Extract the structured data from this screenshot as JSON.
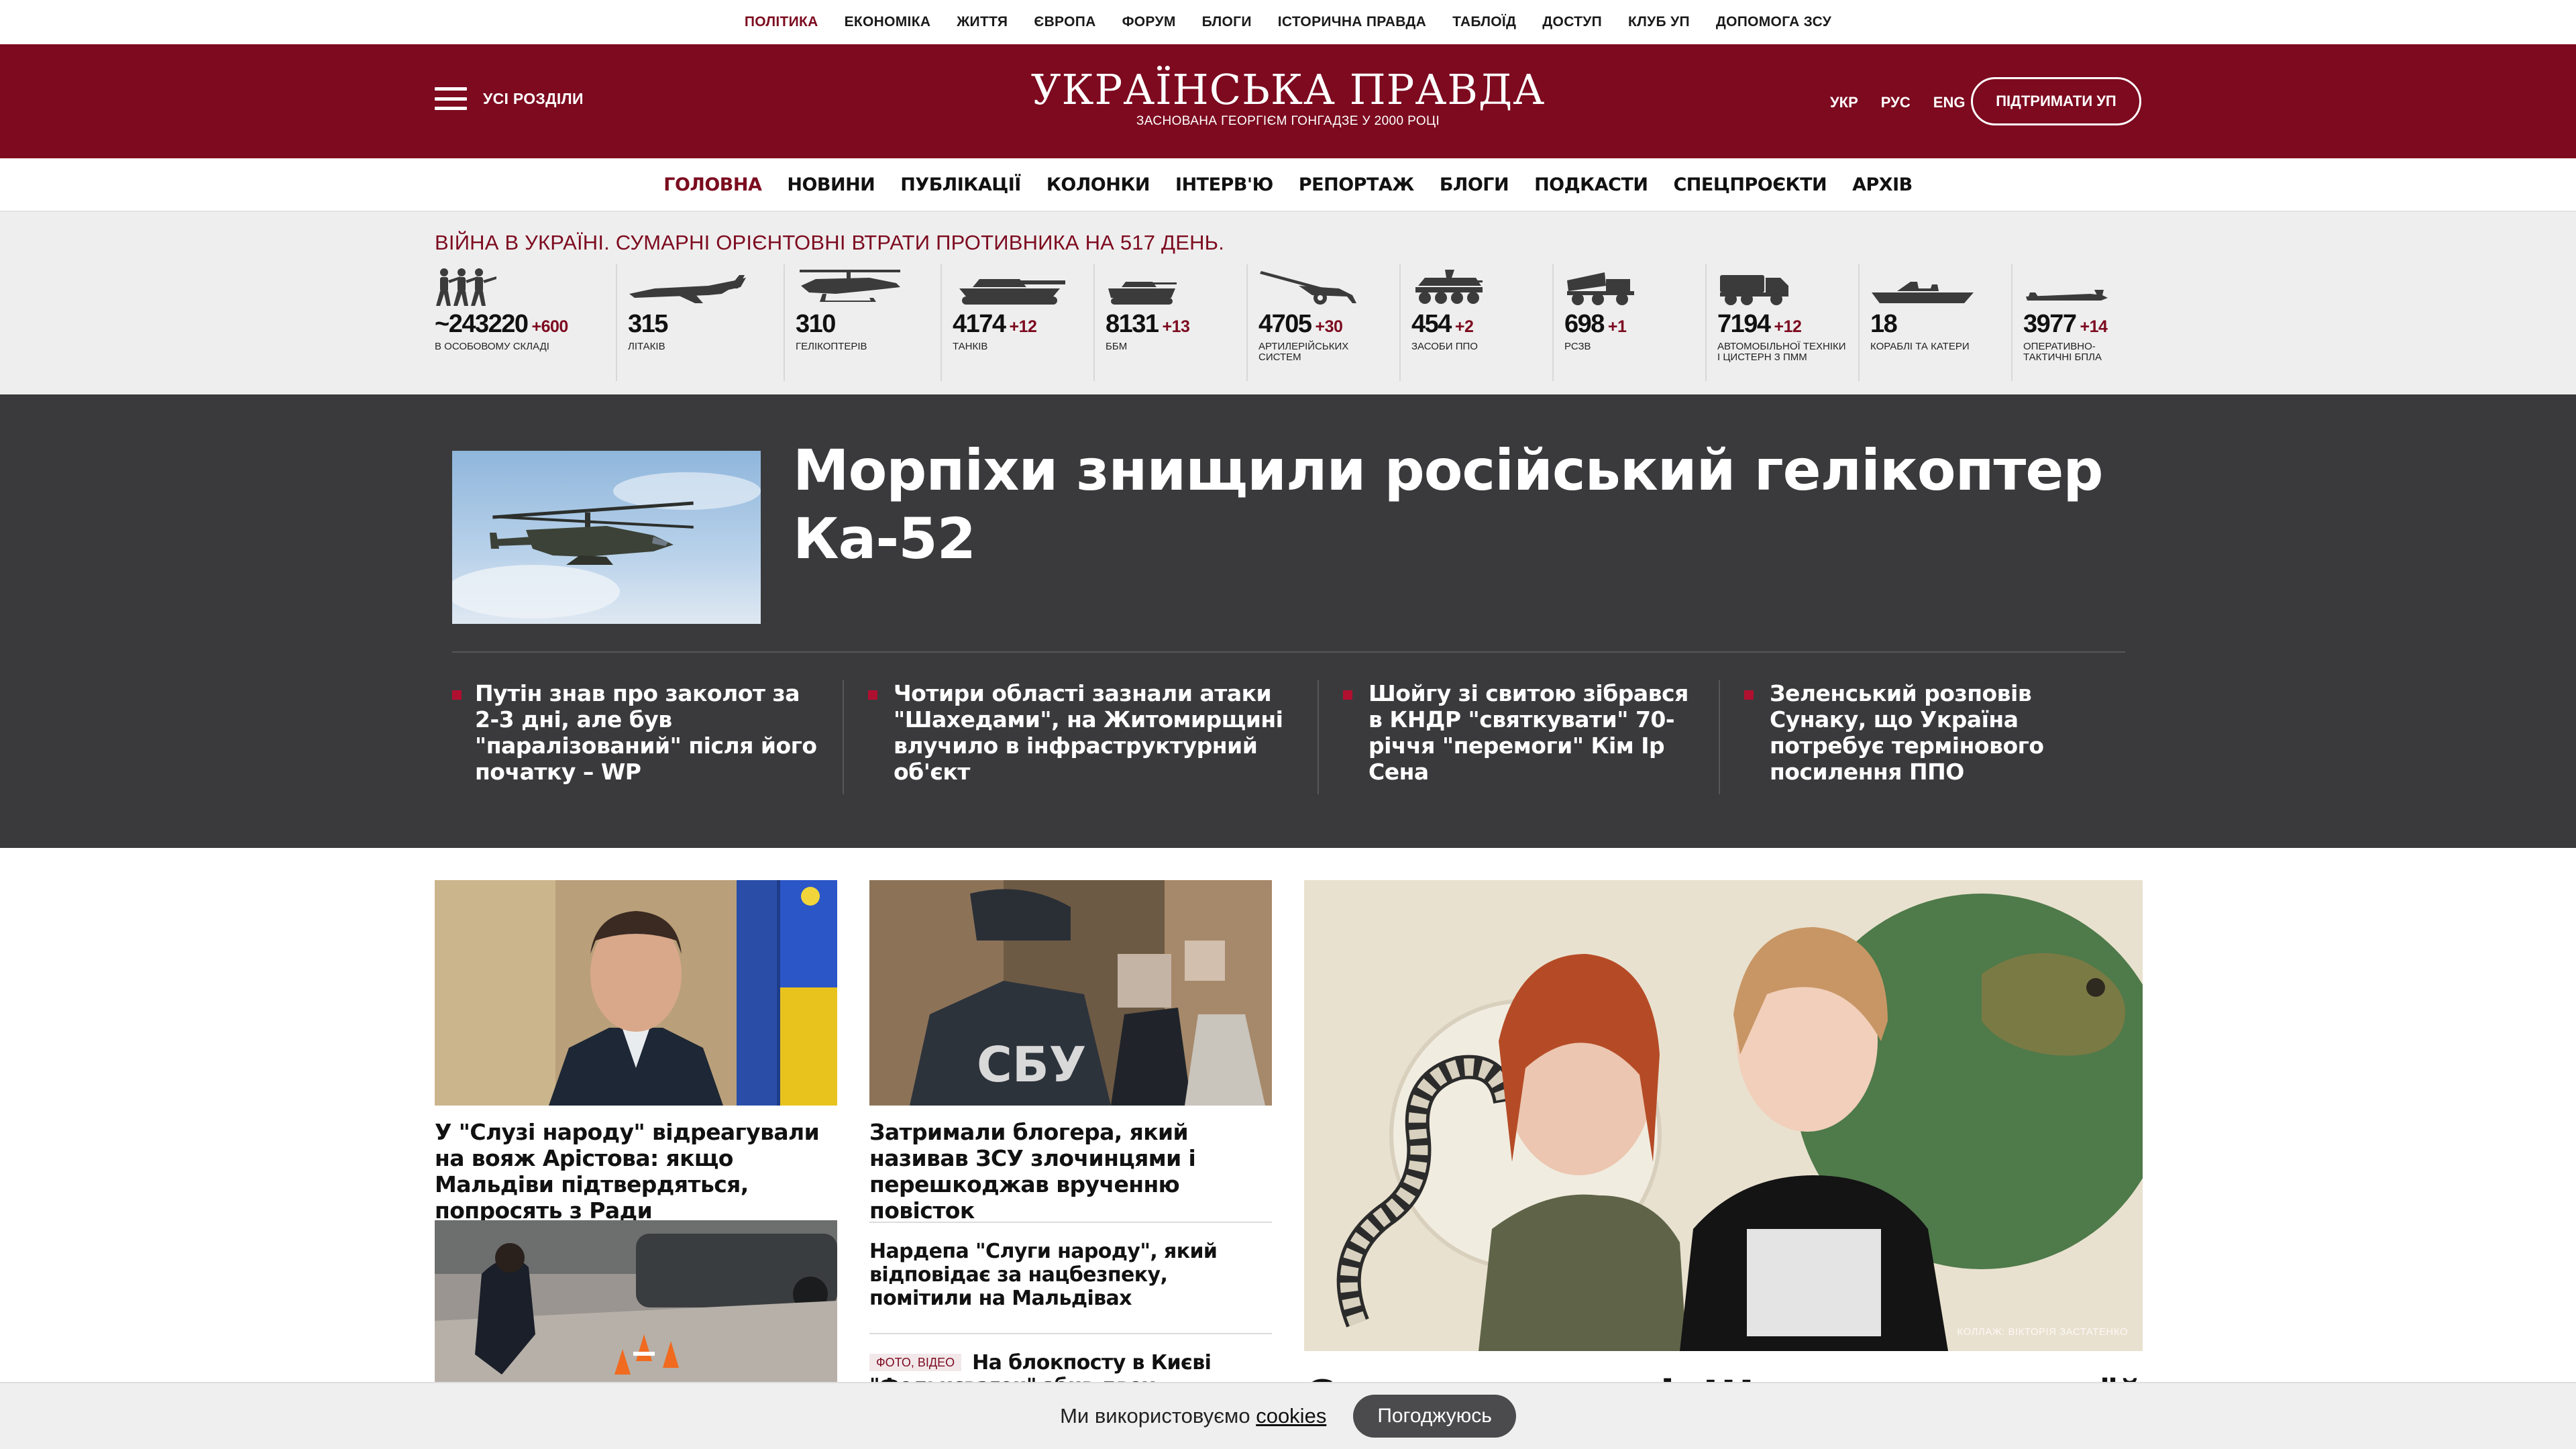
{
  "top_nav": [
    "ПОЛІТИКА",
    "ЕКОНОМІКА",
    "ЖИТТЯ",
    "ЄВРОПА",
    "ФОРУМ",
    "БЛОГИ",
    "ІСТОРИЧНА ПРАВДА",
    "ТАБЛОЇД",
    "ДОСТУП",
    "КЛУБ УП",
    "ДОПОМОГА ЗСУ"
  ],
  "header": {
    "menu_label": "УСІ РОЗДІЛИ",
    "logo_title": "УКРАЇНСЬКА ПРАВДА",
    "logo_subtitle": "ЗАСНОВАНА ГЕОРГІЄМ ГОНГАДЗЕ У 2000 РОЦІ",
    "langs": [
      "УКР",
      "РУС",
      "ENG"
    ],
    "support_label": "ПІДТРИМАТИ УП",
    "brand_color": "#7d0a1f"
  },
  "main_nav": [
    "ГОЛОВНА",
    "НОВИНИ",
    "ПУБЛІКАЦІЇ",
    "КОЛОНКИ",
    "ІНТЕРВ'Ю",
    "РЕПОРТАЖ",
    "БЛОГИ",
    "ПОДКАСТИ",
    "СПЕЦПРОЄКТИ",
    "АРХІВ"
  ],
  "war": {
    "title": "ВІЙНА В УКРАЇНІ. СУМАРНІ ОРІЄНТОВНІ ВТРАТИ ПРОТИВНИКА НА 517 ДЕНЬ.",
    "stats": [
      {
        "icon": "soldiers-icon",
        "value": "~243220",
        "delta": "+600",
        "label": "В ОСОБОВОМУ СКЛАДІ"
      },
      {
        "icon": "aircraft-icon",
        "value": "315",
        "delta": "",
        "label": "ЛІТАКІВ"
      },
      {
        "icon": "helicopter-icon",
        "value": "310",
        "delta": "",
        "label": "ГЕЛІКОПТЕРІВ"
      },
      {
        "icon": "tank-icon",
        "value": "4174",
        "delta": "+12",
        "label": "ТАНКІВ"
      },
      {
        "icon": "ifv-icon",
        "value": "8131",
        "delta": "+13",
        "label": "ББМ"
      },
      {
        "icon": "artillery-icon",
        "value": "4705",
        "delta": "+30",
        "label": "АРТИЛЕРІЙСЬКИХ СИСТЕМ"
      },
      {
        "icon": "air-defense-icon",
        "value": "454",
        "delta": "+2",
        "label": "ЗАСОБИ ППО"
      },
      {
        "icon": "mlrs-icon",
        "value": "698",
        "delta": "+1",
        "label": "РСЗВ"
      },
      {
        "icon": "truck-icon",
        "value": "7194",
        "delta": "+12",
        "label": "АВТОМОБІЛЬНОЇ ТЕХНІКИ І ЦИСТЕРН З ПММ"
      },
      {
        "icon": "ship-icon",
        "value": "18",
        "delta": "",
        "label": "КОРАБЛІ ТА КАТЕРИ"
      },
      {
        "icon": "drone-icon",
        "value": "3977",
        "delta": "+14",
        "label": "ОПЕРАТИВНО-ТАКТИЧНІ БПЛА"
      }
    ]
  },
  "hero": {
    "title": "Морпіхи знищили російський гелікоптер Ка-52",
    "news": [
      "Путін знав про заколот за 2-3 дні, але був \"паралізований\" після його початку – WP",
      "Чотири області зазнали атаки \"Шахедами\", на Житомирщині влучило в інфраструктурний об'єкт",
      "Шойгу зі свитою зібрався в КНДР \"святкувати\" 70-річчя \"перемоги\" Кім Ір Сена",
      "Зеленський розповів Сунаку, що Україна потребує термінового посилення ППО"
    ]
  },
  "feed": {
    "card1": "У \"Слузі народу\" відреагували на вояж Арістова: якщо Мальдіви підтвердяться, попросять з Ради",
    "card2": "Затримали блогера, який називав ЗСУ злочинцями і перешкоджав врученню повісток",
    "small1": "Нардепа \"Слуги народу\", який відповідає за нацбезпеку, помітили на Мальдівах",
    "small2_tag": "ФОТО, ВІДЕО",
    "small2": "На блокпосту в Києві \"Фольксваген\" збив двох поліцейських",
    "big_caption": "Сестри по крові. Що кажуть у своїй",
    "photo_credit": "КОЛЛАЖ: ВІКТОРІЯ ЗАСТАТЕНКО"
  },
  "cookie": {
    "text": "Ми використовуємо",
    "link": "cookies",
    "button": "Погоджуюсь"
  }
}
